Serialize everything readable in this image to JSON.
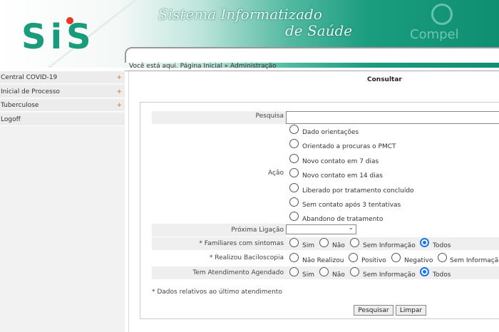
{
  "header": {
    "logo_text": "SiS",
    "title_line1": "Sistema Informatizado",
    "title_line2": "de Saúde",
    "partner": "Compel"
  },
  "breadcrumb": "Você está aqui. Página Inicial » Administração",
  "sidebar": {
    "items": [
      {
        "label": "Central COVID-19",
        "arrow": "+"
      },
      {
        "label": "Inicial de Processo",
        "arrow": "+"
      },
      {
        "label": "Tuberculose",
        "arrow": "+"
      },
      {
        "label": "Logoff",
        "arrow": ""
      }
    ]
  },
  "form": {
    "title": "Consultar",
    "pesquisa_label": "Pesquisa",
    "pesquisa_value": "",
    "acao_label": "Ação",
    "acao_options": [
      "Dado orientações",
      "Orientado a procuras o PMCT",
      "Novo contato em 7 dias",
      "Novo contato em 14 dias",
      "Liberado por tratamento concluído",
      "Sem contato após 3 tentativas",
      "Abandono de tratamento"
    ],
    "proxima_label": "Próxima Ligação",
    "proxima_value": "",
    "familiares_label": "* Familiares com sintomas",
    "familiares_options": [
      "Sim",
      "Não",
      "Sem Informação",
      "Todos"
    ],
    "familiares_selected": "Todos",
    "baciloscopia_label": "* Realizou Baciloscopia",
    "baciloscopia_options": [
      "Não Realizou",
      "Positivo",
      "Negativo",
      "Sem Informação"
    ],
    "atendimento_label": "Tem Atendimento Agendado",
    "atendimento_options": [
      "Sim",
      "Não",
      "Sem Informação",
      "Todos"
    ],
    "atendimento_selected": "Todos",
    "note": "* Dados relativos ao último atendimento",
    "search_button": "Pesquisar",
    "clear_button": "Limpar"
  }
}
